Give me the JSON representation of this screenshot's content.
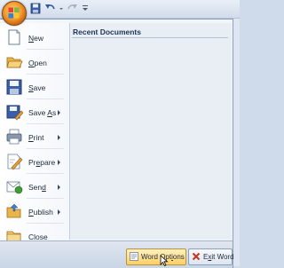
{
  "quick_access": {
    "office_button_icon": "office-logo-icon",
    "items": [
      "save-icon",
      "undo-icon",
      "redo-icon",
      "customize-icon"
    ]
  },
  "menu": {
    "items": [
      {
        "name": "new",
        "label_accel": "N",
        "label_rest": "ew",
        "icon": "new-document-icon",
        "submenu": false
      },
      {
        "name": "open",
        "label_accel": "O",
        "label_rest": "pen",
        "icon": "open-folder-icon",
        "submenu": false
      },
      {
        "name": "save",
        "label_accel": "S",
        "label_rest": "ave",
        "icon": "save-disk-icon",
        "submenu": false
      },
      {
        "name": "save-as",
        "label_pre": "Save ",
        "label_accel": "A",
        "label_rest": "s",
        "icon": "save-as-icon",
        "submenu": true
      },
      {
        "name": "print",
        "label_accel": "P",
        "label_rest": "rint",
        "icon": "printer-icon",
        "submenu": true
      },
      {
        "name": "prepare",
        "label_pre": "Pr",
        "label_accel": "e",
        "label_rest": "pare",
        "icon": "prepare-icon",
        "submenu": true
      },
      {
        "name": "send",
        "label_pre": "Sen",
        "label_accel": "d",
        "label_rest": "",
        "icon": "send-icon",
        "submenu": true
      },
      {
        "name": "publish",
        "label_accel": "P",
        "label_rest": "ublish",
        "icon": "publish-icon",
        "submenu": true
      },
      {
        "name": "close",
        "label_accel": "C",
        "label_rest": "lose",
        "icon": "close-folder-icon",
        "submenu": false
      }
    ]
  },
  "recent": {
    "title": "Recent Documents"
  },
  "footer": {
    "word_options": {
      "pre": "Word Opt",
      "accel": "i",
      "rest": "ons"
    },
    "exit_word": {
      "pre": "E",
      "accel": "x",
      "rest": "it Word"
    }
  },
  "colors": {
    "accent": "#f39a2d",
    "hover": "#ffcf62",
    "panel": "#e9eef4"
  }
}
